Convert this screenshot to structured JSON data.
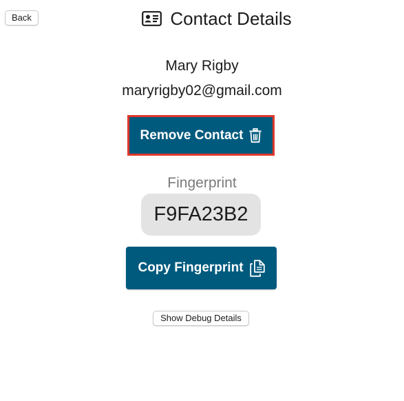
{
  "header": {
    "back_label": "Back",
    "title": "Contact Details",
    "title_icon": "contact-card-icon"
  },
  "contact": {
    "name": "Mary Rigby",
    "email": "maryrigby02@gmail.com"
  },
  "actions": {
    "remove_label": "Remove Contact",
    "remove_icon": "trash-icon",
    "copy_label": "Copy Fingerprint",
    "copy_icon": "copy-icon",
    "debug_label": "Show Debug Details"
  },
  "fingerprint": {
    "label": "Fingerprint",
    "value": "F9FA23B2"
  },
  "colors": {
    "primary": "#005a7e",
    "highlight": "#e0372b",
    "fingerprint_bg": "#e3e3e3"
  }
}
